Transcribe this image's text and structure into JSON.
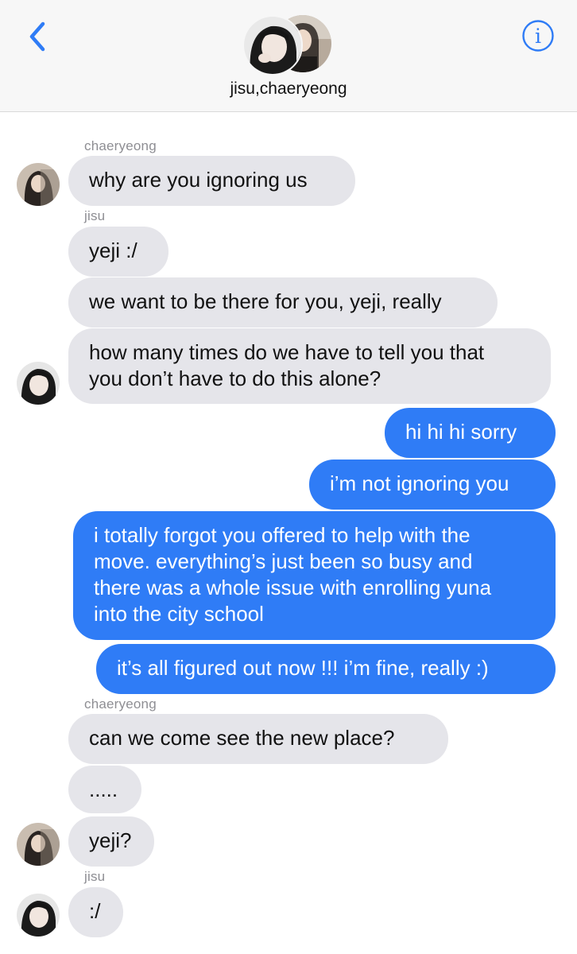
{
  "header": {
    "group_name": "jisu,chaeryeong",
    "back_icon": "chevron-left-icon",
    "info_icon": "info-icon",
    "info_glyph": "i",
    "accent": "#2f7cf6"
  },
  "colors": {
    "incoming_bubble": "#e5e5ea",
    "outgoing_bubble": "#2f7cf6",
    "sender_label": "#8e8e93"
  },
  "messages": [
    {
      "sender": "chaeryeong",
      "text": "why are you ignoring us"
    },
    {
      "sender": "jisu",
      "text": "yeji :/"
    },
    {
      "text": "we want to be there for you, yeji, really"
    },
    {
      "text": "how many times do we have to tell you that\nyou don’t have to do this alone?"
    },
    {
      "text": "hi hi hi sorry"
    },
    {
      "text": "i’m not ignoring you"
    },
    {
      "text": "i totally forgot you offered to help with the\nmove. everything’s just been so busy and\nthere was a whole issue with enrolling yuna\ninto the city school"
    },
    {
      "text": "it’s all figured out now !!! i’m fine, really :)"
    },
    {
      "sender": "chaeryeong",
      "text": "can we come see the new place?"
    },
    {
      "text": "....."
    },
    {
      "text": "yeji?"
    },
    {
      "sender": "jisu",
      "text": ":/"
    }
  ]
}
